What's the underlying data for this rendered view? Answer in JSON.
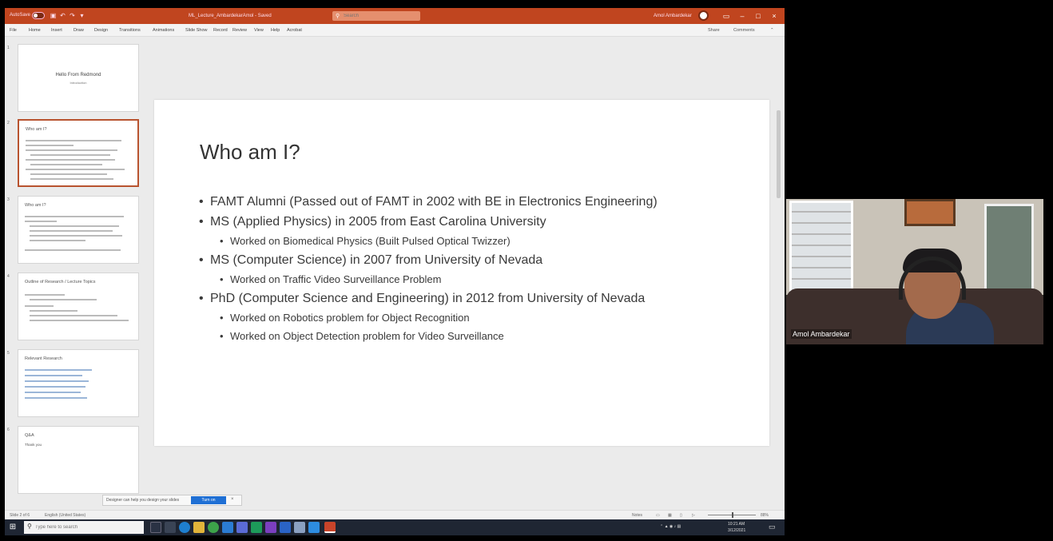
{
  "title_bar": {
    "autosave_label": "AutoSave",
    "document_title": "ML_Lecture_AmbardekarAmol - Saved",
    "search_placeholder": "Search",
    "user_name": "Amol Ambardekar",
    "minimize_icon": "minimize-icon",
    "maximize_icon": "maximize-icon",
    "close_icon": "close-icon"
  },
  "ribbon": {
    "tabs": [
      "File",
      "Home",
      "Insert",
      "Draw",
      "Design",
      "Transitions",
      "Animations",
      "Slide Show",
      "Record",
      "Review",
      "View",
      "Help",
      "Acrobat"
    ],
    "share_label": "Share",
    "comments_label": "Comments"
  },
  "thumbnails": [
    {
      "number": "1",
      "title": "Hello From Redmond",
      "subtitle": "Introduction"
    },
    {
      "number": "2",
      "title": "Who am I?"
    },
    {
      "number": "3",
      "title": "Who am I?"
    },
    {
      "number": "4",
      "title": "Outline of Research / Lecture Topics"
    },
    {
      "number": "5",
      "title": "Relevant Research"
    },
    {
      "number": "6",
      "title": "Q&A",
      "subtitle": "Thank you"
    }
  ],
  "slide": {
    "title": "Who am I?",
    "bullets": [
      {
        "text": "FAMT Alumni (Passed out of FAMT in 2002 with BE in Electronics Engineering)",
        "sub": []
      },
      {
        "text": "MS (Applied Physics) in 2005 from East Carolina University",
        "sub": [
          "Worked on Biomedical Physics (Built Pulsed Optical Twizzer)"
        ]
      },
      {
        "text": "MS (Computer Science) in 2007 from University of Nevada",
        "sub": [
          "Worked on Traffic Video Surveillance  Problem"
        ]
      },
      {
        "text": "PhD (Computer Science and Engineering) in 2012 from University of Nevada",
        "sub": [
          "Worked on Robotics problem for Object Recognition",
          "Worked on Object Detection problem for Video Surveillance"
        ]
      }
    ]
  },
  "notification": {
    "text": "Designer can help you design your slides",
    "button_label": "Turn on",
    "close_label": "×"
  },
  "status_bar": {
    "slide_counter": "Slide 2 of 6",
    "language": "English (United States)",
    "notes_label": "Notes",
    "zoom": "88%"
  },
  "taskbar": {
    "search_placeholder": "Type here to search",
    "time": "10:21 AM",
    "date": "3/12/2021"
  },
  "video": {
    "participant_name": "Amol Ambardekar"
  },
  "colors": {
    "accent": "#c0451f",
    "taskbar": "#1f2633",
    "notif_button": "#1f6fd4"
  }
}
